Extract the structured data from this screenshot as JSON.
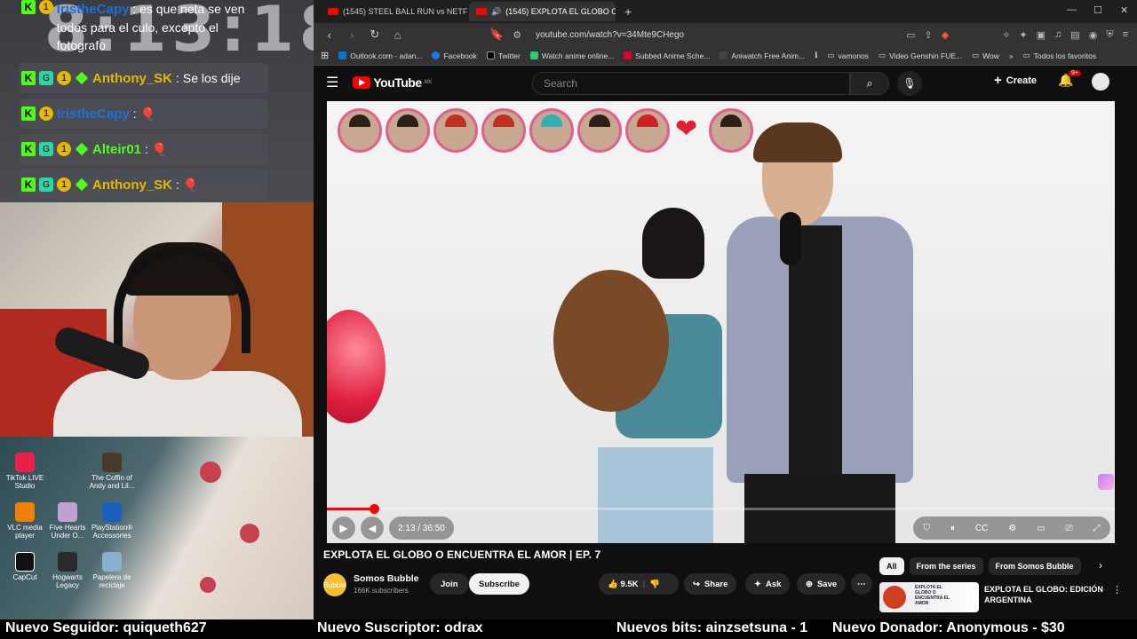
{
  "stream": {
    "clock": "8:13:18",
    "chat": [
      {
        "user": "IristheCapy",
        "color": "#1e6fd9",
        "message": "es que neta se ven todos para el culo, excepto el fotografo"
      },
      {
        "user": "Anthony_SK",
        "color": "#e6b800",
        "message": "Se los dije"
      },
      {
        "user": "IristheCapy",
        "color": "#1e6fd9",
        "message": "🎈"
      },
      {
        "user": "Alteir01",
        "color": "#53fc18",
        "message": "🎈"
      },
      {
        "user": "Anthony_SK",
        "color": "#e6b800",
        "message": "🎈"
      }
    ],
    "desktop_icons": [
      {
        "label": "TikTok LIVE Studio",
        "icon": "tiktok-icon",
        "color": "#e8204a"
      },
      {
        "label": "The Coffin of Andy and Lil...",
        "icon": "game-icon",
        "color": "#4a3a2a"
      },
      {
        "label": "VLC media player",
        "icon": "vlc-icon",
        "color": "#f08000"
      },
      {
        "label": "Five Hearts Under O...",
        "icon": "game-icon",
        "color": "#c0a0d0"
      },
      {
        "label": "PlayStation® Accessories",
        "icon": "playstation-icon",
        "color": "#1a60c0"
      },
      {
        "label": "CapCut",
        "icon": "capcut-icon",
        "color": "#111111"
      },
      {
        "label": "Hogwarts Legacy",
        "icon": "game-icon",
        "color": "#2a2a2a"
      },
      {
        "label": "Papelera de reciclaje",
        "icon": "recycle-bin-icon",
        "color": "#8ab0d0"
      }
    ]
  },
  "browser": {
    "tabs": [
      {
        "title": "(1545) STEEL BALL RUN vs NETFLIX ..."
      },
      {
        "title": "(1545) EXPLOTA EL GLOBO O..."
      }
    ],
    "url": "youtube.com/watch?v=34Mte9CHego",
    "bookmarks": [
      "Outlook.com - adan...",
      "Facebook",
      "Twitter",
      "Watch anime online...",
      "Subbed Anime Sche...",
      "Aniwatch Free Anim...",
      "vamonos",
      "Video Genshin FUE...",
      "Wow",
      "Todos los favoritos"
    ],
    "bookmark_colors": [
      "#0078d4",
      "#1877f2",
      "#000000",
      "#2ecc71",
      "#e0002a",
      "#444444",
      "#888888",
      "#888888",
      "#888888",
      "#888888"
    ]
  },
  "youtube": {
    "logo": "YouTube",
    "region": "MX",
    "search_placeholder": "Search",
    "create_label": "Create",
    "notifications": "9+",
    "player": {
      "time": "2:13 / 36:50",
      "progress": 0.06
    },
    "video_title": "EXPLOTA EL GLOBO O ENCUENTRA EL AMOR | EP. 7",
    "channel": {
      "name": "Somos Bubble",
      "subscribers": "166K subscribers",
      "avatar_text": "Bubble"
    },
    "join_label": "Join",
    "subscribe_label": "Subscribe",
    "likes": "9.5K",
    "share_label": "Share",
    "ask_label": "Ask",
    "save_label": "Save",
    "chips": [
      "All",
      "From the series",
      "From Somos Bubble"
    ],
    "reco": {
      "title": "EXPLOTA EL GLOBO: EDICIÓN ARGENTINA",
      "thumb_text": "EXPLOTA EL GLOBO O ENCUENTRA EL AMOR"
    }
  },
  "ticker": {
    "follower": "Nuevo Seguidor: quiqueth627",
    "subscriber": "Nuevo Suscriptor: odrax",
    "bits": "Nuevos bits: ainzsetsuna - 1",
    "donor": "Nuevo Donador: Anonymous - $30"
  }
}
